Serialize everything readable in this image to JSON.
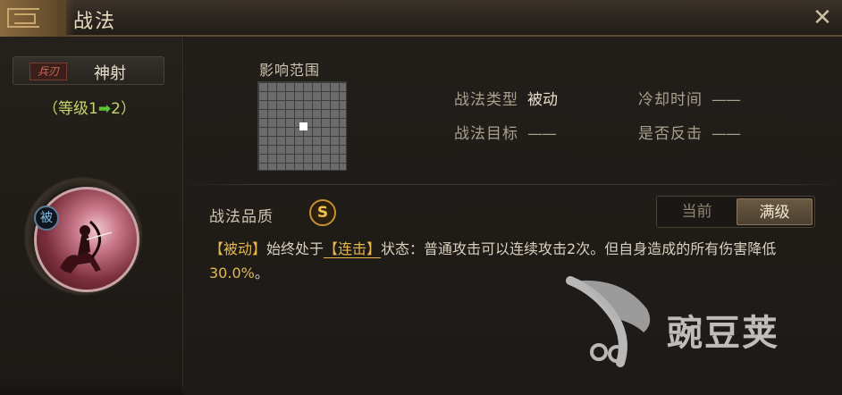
{
  "window": {
    "title": "战法",
    "close_icon": "close-icon"
  },
  "left": {
    "weapon_badge": "兵刃",
    "skill_name": "神射",
    "level_prefix": "（等级1",
    "level_arrow": "➡",
    "level_suffix": "2）",
    "passive_badge": "被"
  },
  "range": {
    "label": "影响范围",
    "grid_size": 10,
    "highlighted_cell": "center"
  },
  "info": {
    "type_label": "战法类型",
    "type_value": "被动",
    "cooldown_label": "冷却时间",
    "cooldown_value": "——",
    "target_label": "战法目标",
    "target_value": "——",
    "counter_label": "是否反击",
    "counter_value": "——"
  },
  "quality": {
    "label": "战法品质",
    "grade": "S"
  },
  "toggle": {
    "current": "当前",
    "max": "满级",
    "selected": "max"
  },
  "description": {
    "tag_passive": "【被动】",
    "part1": "始终处于",
    "tag_combo": "【连击】",
    "part2": "状态：普通攻击可以连续攻击2次。但自身造成的所有伤害降低",
    "percent": "30.0%",
    "part3": "。"
  },
  "watermark": {
    "text": "豌豆荚"
  },
  "colors": {
    "accent_gold": "#e6b84c",
    "level_green": "#5cc23a",
    "passive_blue": "#7cc0ee"
  }
}
